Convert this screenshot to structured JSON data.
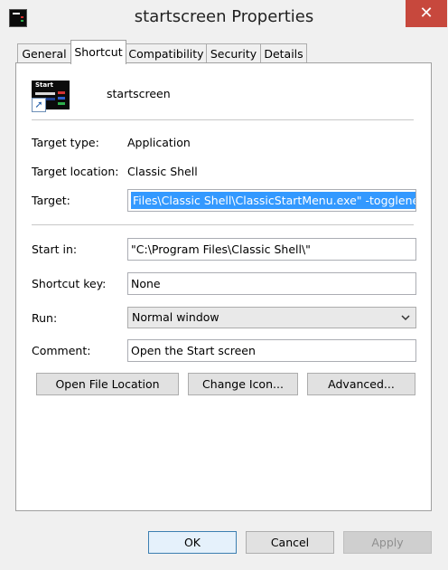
{
  "window": {
    "title": "startscreen Properties",
    "close_glyph": "✕"
  },
  "tabs": [
    {
      "label": "General"
    },
    {
      "label": "Shortcut",
      "active": true
    },
    {
      "label": "Compatibility"
    },
    {
      "label": "Security"
    },
    {
      "label": "Details"
    }
  ],
  "shortcut": {
    "name": "startscreen",
    "icon_label": "Start",
    "target_type_label": "Target type:",
    "target_type_value": "Application",
    "target_location_label": "Target location:",
    "target_location_value": "Classic Shell",
    "target_label": "Target:",
    "target_value": "Files\\Classic Shell\\ClassicStartMenu.exe\" -togglenew",
    "start_in_label": "Start in:",
    "start_in_value": "\"C:\\Program Files\\Classic Shell\\\"",
    "shortcut_key_label": "Shortcut key:",
    "shortcut_key_value": "None",
    "run_label": "Run:",
    "run_value": "Normal window",
    "comment_label": "Comment:",
    "comment_value": "Open the Start screen"
  },
  "actions": {
    "open_file_location": "Open File Location",
    "change_icon": "Change Icon...",
    "advanced": "Advanced..."
  },
  "footer": {
    "ok": "OK",
    "cancel": "Cancel",
    "apply": "Apply"
  },
  "colors": {
    "selection": "#3399ff",
    "close": "#c7483d"
  }
}
